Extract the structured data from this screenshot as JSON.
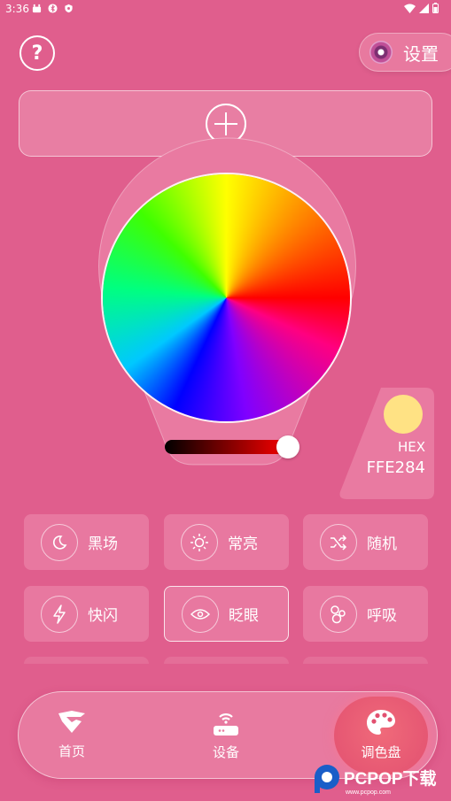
{
  "status_bar": {
    "time": "3:36"
  },
  "header": {
    "help_label": "?",
    "settings_label": "设置"
  },
  "color": {
    "hex_label": "HEX",
    "hex_value": "FFE284",
    "swatch": "#FFE284",
    "brightness_fraction": 0.9
  },
  "modes": [
    {
      "label": "黑场",
      "icon": "moon-icon"
    },
    {
      "label": "常亮",
      "icon": "sun-icon"
    },
    {
      "label": "随机",
      "icon": "shuffle-icon"
    },
    {
      "label": "快闪",
      "icon": "lightning-icon"
    },
    {
      "label": "眨眼",
      "icon": "eye-icon"
    },
    {
      "label": "呼吸",
      "icon": "bubbles-icon"
    }
  ],
  "active_mode": "眨眼",
  "nav": [
    {
      "label": "首页",
      "icon": "home-logo-icon"
    },
    {
      "label": "设备",
      "icon": "router-icon"
    },
    {
      "label": "调色盘",
      "icon": "palette-icon"
    }
  ],
  "active_nav": "调色盘",
  "watermark": {
    "text": "PCPOP下载",
    "subtext": "www.pcpop.com"
  },
  "colors": {
    "background": "#e05e8d",
    "panel": "#e87ea3",
    "accent": "#e25070"
  }
}
